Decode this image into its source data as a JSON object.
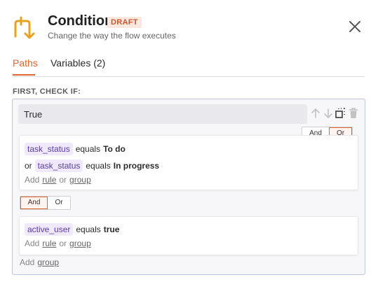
{
  "header": {
    "title": "Condition",
    "badge": "DRAFT",
    "subtitle": "Change the way the flow executes",
    "icon": "flow-split-icon",
    "close_icon": "close-icon"
  },
  "tabs": [
    {
      "label": "Paths",
      "active": true
    },
    {
      "label": "Variables (2)",
      "active": false
    }
  ],
  "section_label": "FIRST, CHECK IF:",
  "condition": {
    "value": "True",
    "tools": [
      "arrow-up-icon",
      "arrow-down-icon",
      "copy-icon",
      "trash-icon"
    ]
  },
  "top_toggle": {
    "and": "And",
    "or": "Or",
    "selected": "Or"
  },
  "group1": {
    "rules": [
      {
        "prefix": "",
        "variable": "task_status",
        "operator": "equals",
        "value": "To do"
      },
      {
        "prefix": "or",
        "variable": "task_status",
        "operator": "equals",
        "value": "In progress"
      }
    ],
    "add_text": "Add",
    "rule_link": "rule",
    "or_text": "or",
    "group_link": "group"
  },
  "middle_toggle": {
    "and": "And",
    "or": "Or",
    "selected": "And"
  },
  "group2": {
    "rules": [
      {
        "variable": "active_user",
        "operator": "equals",
        "value": "true"
      }
    ],
    "add_text": "Add",
    "rule_link": "rule",
    "or_text": "or",
    "group_link": "group"
  },
  "footer": {
    "add_text": "Add",
    "group_link": "group"
  },
  "colors": {
    "accent": "#e0642f",
    "chip_bg": "#efe9fb",
    "chip_text": "#5a3aa6",
    "border": "#bcc3da"
  }
}
